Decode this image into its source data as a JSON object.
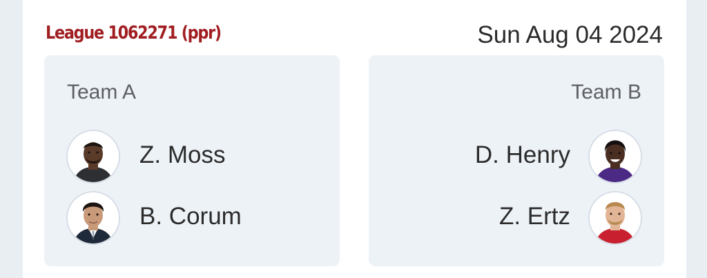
{
  "header": {
    "league_title": "League 1062271 (ppr)",
    "date": "Sun Aug 04 2024"
  },
  "teams": [
    {
      "name": "Team A",
      "players": [
        {
          "name": "Z. Moss",
          "jersey_color": "#2e2f33"
        },
        {
          "name": "B. Corum",
          "jersey_color": "#1e2a3a"
        }
      ]
    },
    {
      "name": "Team B",
      "players": [
        {
          "name": "D. Henry",
          "jersey_color": "#4b2a86"
        },
        {
          "name": "Z. Ertz",
          "jersey_color": "#c8202e"
        }
      ]
    }
  ],
  "colors": {
    "league_title": "#a01e22",
    "card_background": "#edf2f7",
    "page_background": "#e9eef3"
  }
}
